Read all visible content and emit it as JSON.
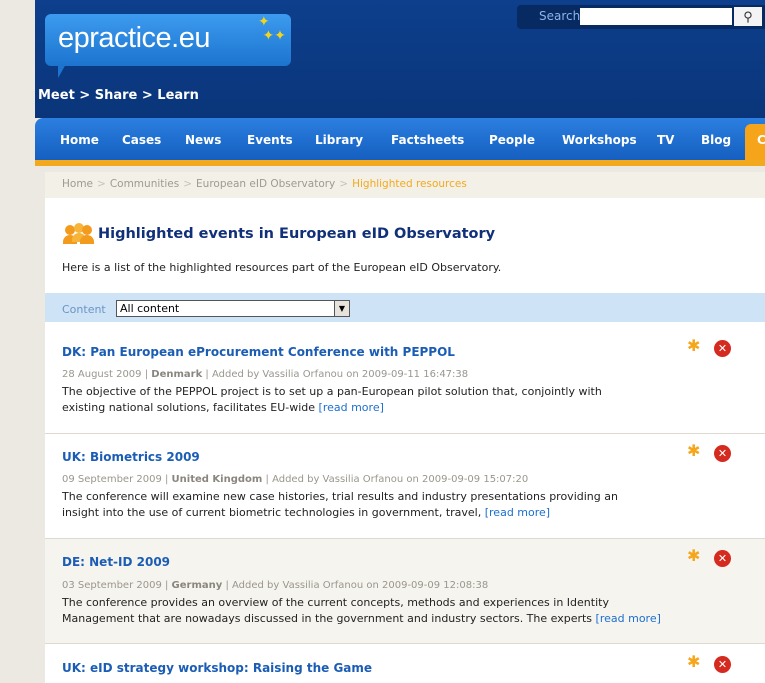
{
  "header": {
    "logo_text": "epractice.eu",
    "tagline": "Meet > Share > Learn",
    "search": {
      "label": "Search",
      "value": "",
      "placeholder": ""
    }
  },
  "nav": {
    "items": [
      "Home",
      "Cases",
      "News",
      "Events",
      "Library",
      "Factsheets",
      "People",
      "Workshops",
      "TV",
      "Blog"
    ],
    "active_partial": "C"
  },
  "breadcrumb": {
    "items": [
      "Home",
      "Communities",
      "European eID Observatory"
    ],
    "current": "Highlighted resources"
  },
  "page": {
    "title": "Highlighted events in European eID Observatory",
    "intro": "Here is a list of the highlighted resources part of the European eID Observatory."
  },
  "filter": {
    "label": "Content",
    "selected": "All content"
  },
  "events": [
    {
      "title": "DK: Pan European eProcurement Conference with PEPPOL",
      "date": "28 August 2009",
      "country": "Denmark",
      "added": "Added by Vassilia Orfanou on 2009-09-11 16:47:38",
      "desc_line1": "The objective of the PEPPOL project is to set up a pan-European pilot solution that, conjointly with",
      "desc_line2": "existing national solutions, facilitates EU-wide",
      "read_more": "[read more]"
    },
    {
      "title": "UK: Biometrics 2009",
      "date": "09 September 2009",
      "country": "United Kingdom",
      "added": "Added by Vassilia Orfanou on 2009-09-09 15:07:20",
      "desc_line1": "The conference will examine new case histories, trial results and industry presentations providing an",
      "desc_line2": "insight into the use of current biometric technologies in government, travel,",
      "read_more": "[read more]"
    },
    {
      "title": "DE: Net-ID 2009",
      "date": "03 September 2009",
      "country": "Germany",
      "added": "Added by Vassilia Orfanou on 2009-09-09 12:08:38",
      "desc_line1": "The conference provides an overview of the current concepts, methods and experiences in Identity",
      "desc_line2": "Management that are nowadays discussed in the government and industry sectors. The experts",
      "read_more": "[read more]"
    },
    {
      "title": "UK: eID strategy workshop: Raising the Game"
    }
  ],
  "colors": {
    "header_blue": "#0b3c86",
    "nav_blue": "#1a6ed1",
    "accent_orange": "#f3a91d",
    "link_blue": "#1b5db5",
    "delete_red": "#d52a1f"
  },
  "icons": {
    "search": "magnifier-icon",
    "people": "people-icon",
    "highlight": "star-icon",
    "remove": "delete-icon"
  }
}
